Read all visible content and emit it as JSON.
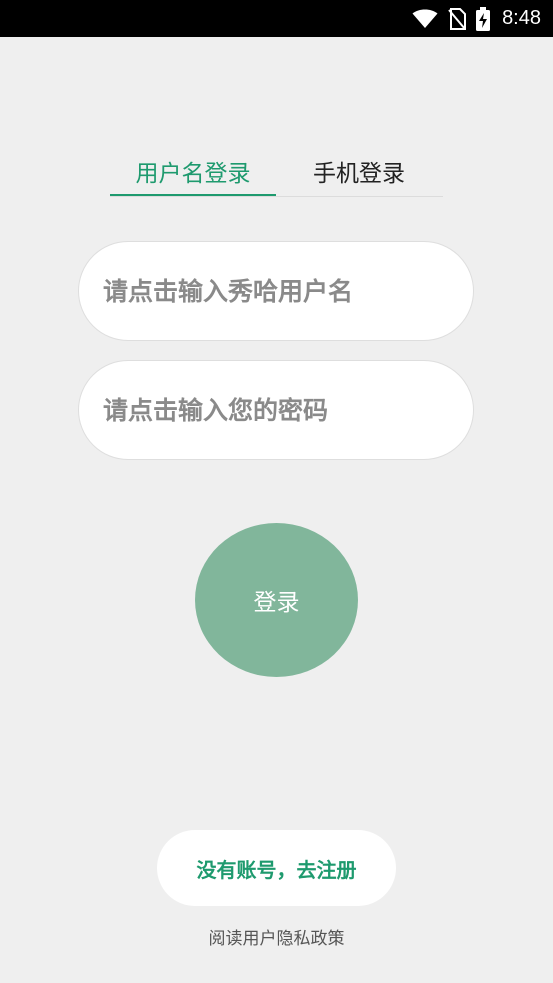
{
  "status_bar": {
    "time": "8:48",
    "icons": [
      "wifi-icon",
      "no-sim-icon",
      "battery-charging-icon"
    ]
  },
  "tabs": [
    {
      "label": "用户名登录",
      "active": true
    },
    {
      "label": "手机登录",
      "active": false
    }
  ],
  "form": {
    "username_placeholder": "请点击输入秀哈用户名",
    "username_value": "",
    "password_placeholder": "请点击输入您的密码",
    "password_value": ""
  },
  "login_label": "登录",
  "register_label": "没有账号，去注册",
  "privacy_label": "阅读用户隐私政策",
  "colors": {
    "accent": "#1e9a6e",
    "login_button": "#81b69b",
    "background": "#efefef"
  }
}
